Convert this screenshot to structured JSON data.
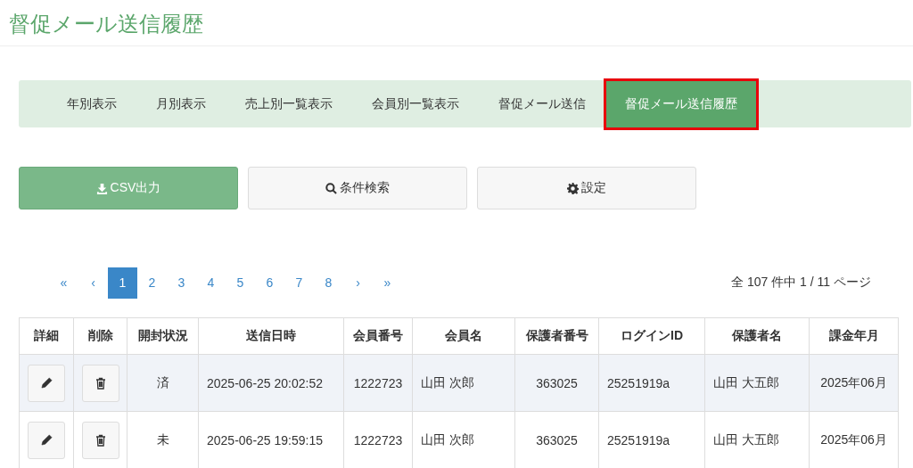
{
  "page_title": "督促メール送信履歴",
  "tabs": [
    {
      "label": "年別表示",
      "selected": false,
      "highlighted": false
    },
    {
      "label": "月別表示",
      "selected": false,
      "highlighted": false
    },
    {
      "label": "売上別一覧表示",
      "selected": false,
      "highlighted": false
    },
    {
      "label": "会員別一覧表示",
      "selected": false,
      "highlighted": false
    },
    {
      "label": "督促メール送信",
      "selected": false,
      "highlighted": false
    },
    {
      "label": "督促メール送信履歴",
      "selected": true,
      "highlighted": true
    }
  ],
  "actions": [
    {
      "label": "CSV出力",
      "kind": "download",
      "primary": true
    },
    {
      "label": "条件検索",
      "kind": "search",
      "primary": false
    },
    {
      "label": "設定",
      "kind": "settings",
      "primary": false
    }
  ],
  "pagination": {
    "first": "«",
    "prev": "‹",
    "pages": [
      {
        "label": "1",
        "selected": true
      },
      {
        "label": "2",
        "selected": false
      },
      {
        "label": "3",
        "selected": false
      },
      {
        "label": "4",
        "selected": false
      },
      {
        "label": "5",
        "selected": false
      },
      {
        "label": "6",
        "selected": false
      },
      {
        "label": "7",
        "selected": false
      },
      {
        "label": "8",
        "selected": false
      }
    ],
    "next": "›",
    "last": "»",
    "summary": "全 107 件中 1 / 11 ページ"
  },
  "table": {
    "columns": [
      {
        "label": "詳細"
      },
      {
        "label": "削除"
      },
      {
        "label": "開封状況"
      },
      {
        "label": "送信日時"
      },
      {
        "label": "会員番号"
      },
      {
        "label": "会員名"
      },
      {
        "label": "保護者番号"
      },
      {
        "label": "ログインID"
      },
      {
        "label": "保護者名"
      },
      {
        "label": "課金年月"
      }
    ],
    "rows": [
      {
        "status": "済",
        "sent_at": "2025-06-25 20:02:52",
        "member_no": "1222723",
        "member_name": "山田 次郎",
        "guardian_no": "363025",
        "login_id": "25251919a",
        "guardian_name": "山田 大五郎",
        "billing_month": "2025年06月"
      },
      {
        "status": "未",
        "sent_at": "2025-06-25 19:59:15",
        "member_no": "1222723",
        "member_name": "山田 次郎",
        "guardian_no": "363025",
        "login_id": "25251919a",
        "guardian_name": "山田 大五郎",
        "billing_month": "2025年06月"
      }
    ]
  }
}
